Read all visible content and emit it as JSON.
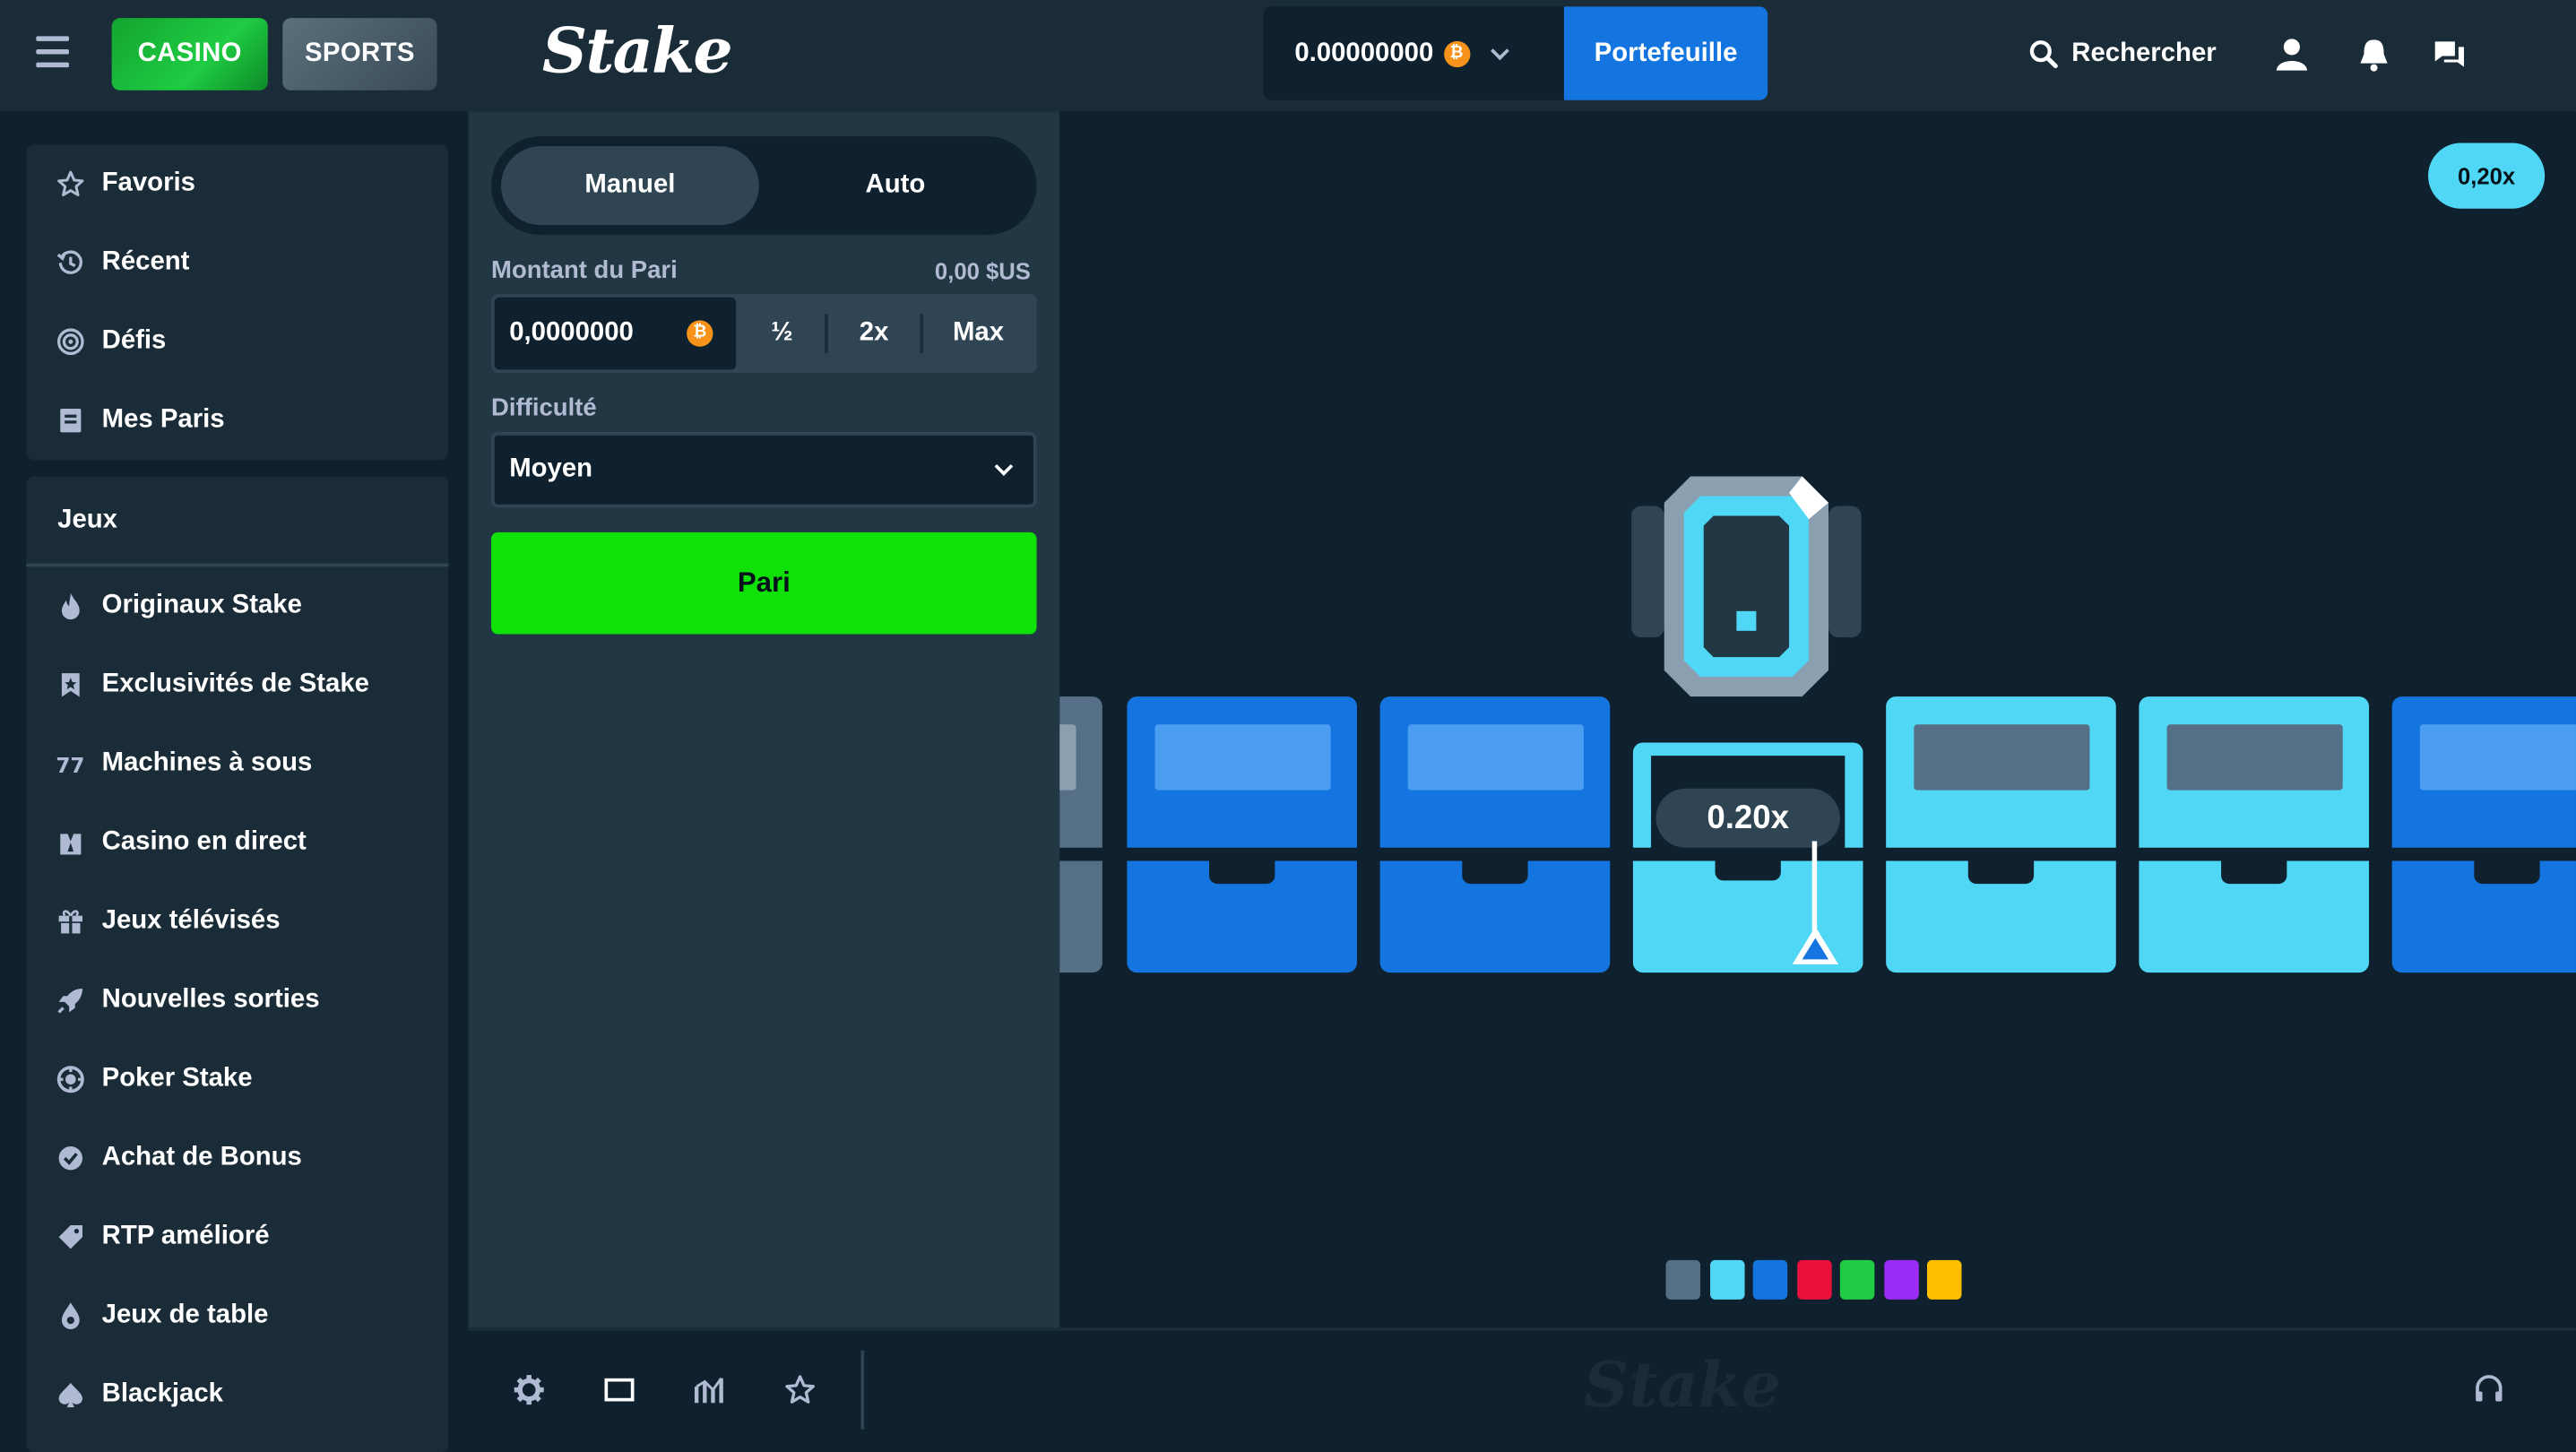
{
  "header": {
    "casino_label": "CASINO",
    "sports_label": "SPORTS",
    "logo": "Stake",
    "balance": "0.00000000",
    "currency_icon": "bitcoin-icon",
    "wallet_label": "Portefeuille",
    "search_label": "Rechercher"
  },
  "sidebar": {
    "top_items": [
      {
        "label": "Favoris",
        "icon": "star-icon"
      },
      {
        "label": "Récent",
        "icon": "history-icon"
      },
      {
        "label": "Défis",
        "icon": "target-icon"
      },
      {
        "label": "Mes Paris",
        "icon": "bets-icon"
      }
    ],
    "games_heading": "Jeux",
    "game_items": [
      {
        "label": "Originaux Stake",
        "icon": "flame-icon"
      },
      {
        "label": "Exclusivités de Stake",
        "icon": "bookmark-star-icon"
      },
      {
        "label": "Machines à sous",
        "icon": "slots-icon"
      },
      {
        "label": "Casino en direct",
        "icon": "live-dealer-icon"
      },
      {
        "label": "Jeux télévisés",
        "icon": "gift-icon"
      },
      {
        "label": "Nouvelles sorties",
        "icon": "rocket-icon"
      },
      {
        "label": "Poker Stake",
        "icon": "poker-chip-icon"
      },
      {
        "label": "Achat de Bonus",
        "icon": "bonus-icon"
      },
      {
        "label": "RTP amélioré",
        "icon": "tag-icon"
      },
      {
        "label": "Jeux de table",
        "icon": "drop-icon"
      },
      {
        "label": "Blackjack",
        "icon": "spade-icon"
      }
    ]
  },
  "panel": {
    "tab_manual": "Manuel",
    "tab_auto": "Auto",
    "bet_amount_label": "Montant du Pari",
    "bet_amount_usd": "0,00 $US",
    "bet_amount_value": "0,0000000",
    "half_label": "½",
    "double_label": "2x",
    "max_label": "Max",
    "difficulty_label": "Difficulté",
    "difficulty_value": "Moyen",
    "bet_button": "Pari"
  },
  "game": {
    "last_multiplier": "0,20x",
    "center_multiplier": "0.20x",
    "palette": [
      "#557086",
      "#4fd7f5",
      "#1475e1",
      "#e9113c",
      "#1fcc43",
      "#9b2cf5",
      "#ffbf00"
    ]
  },
  "footer": {
    "watermark": "Stake"
  }
}
